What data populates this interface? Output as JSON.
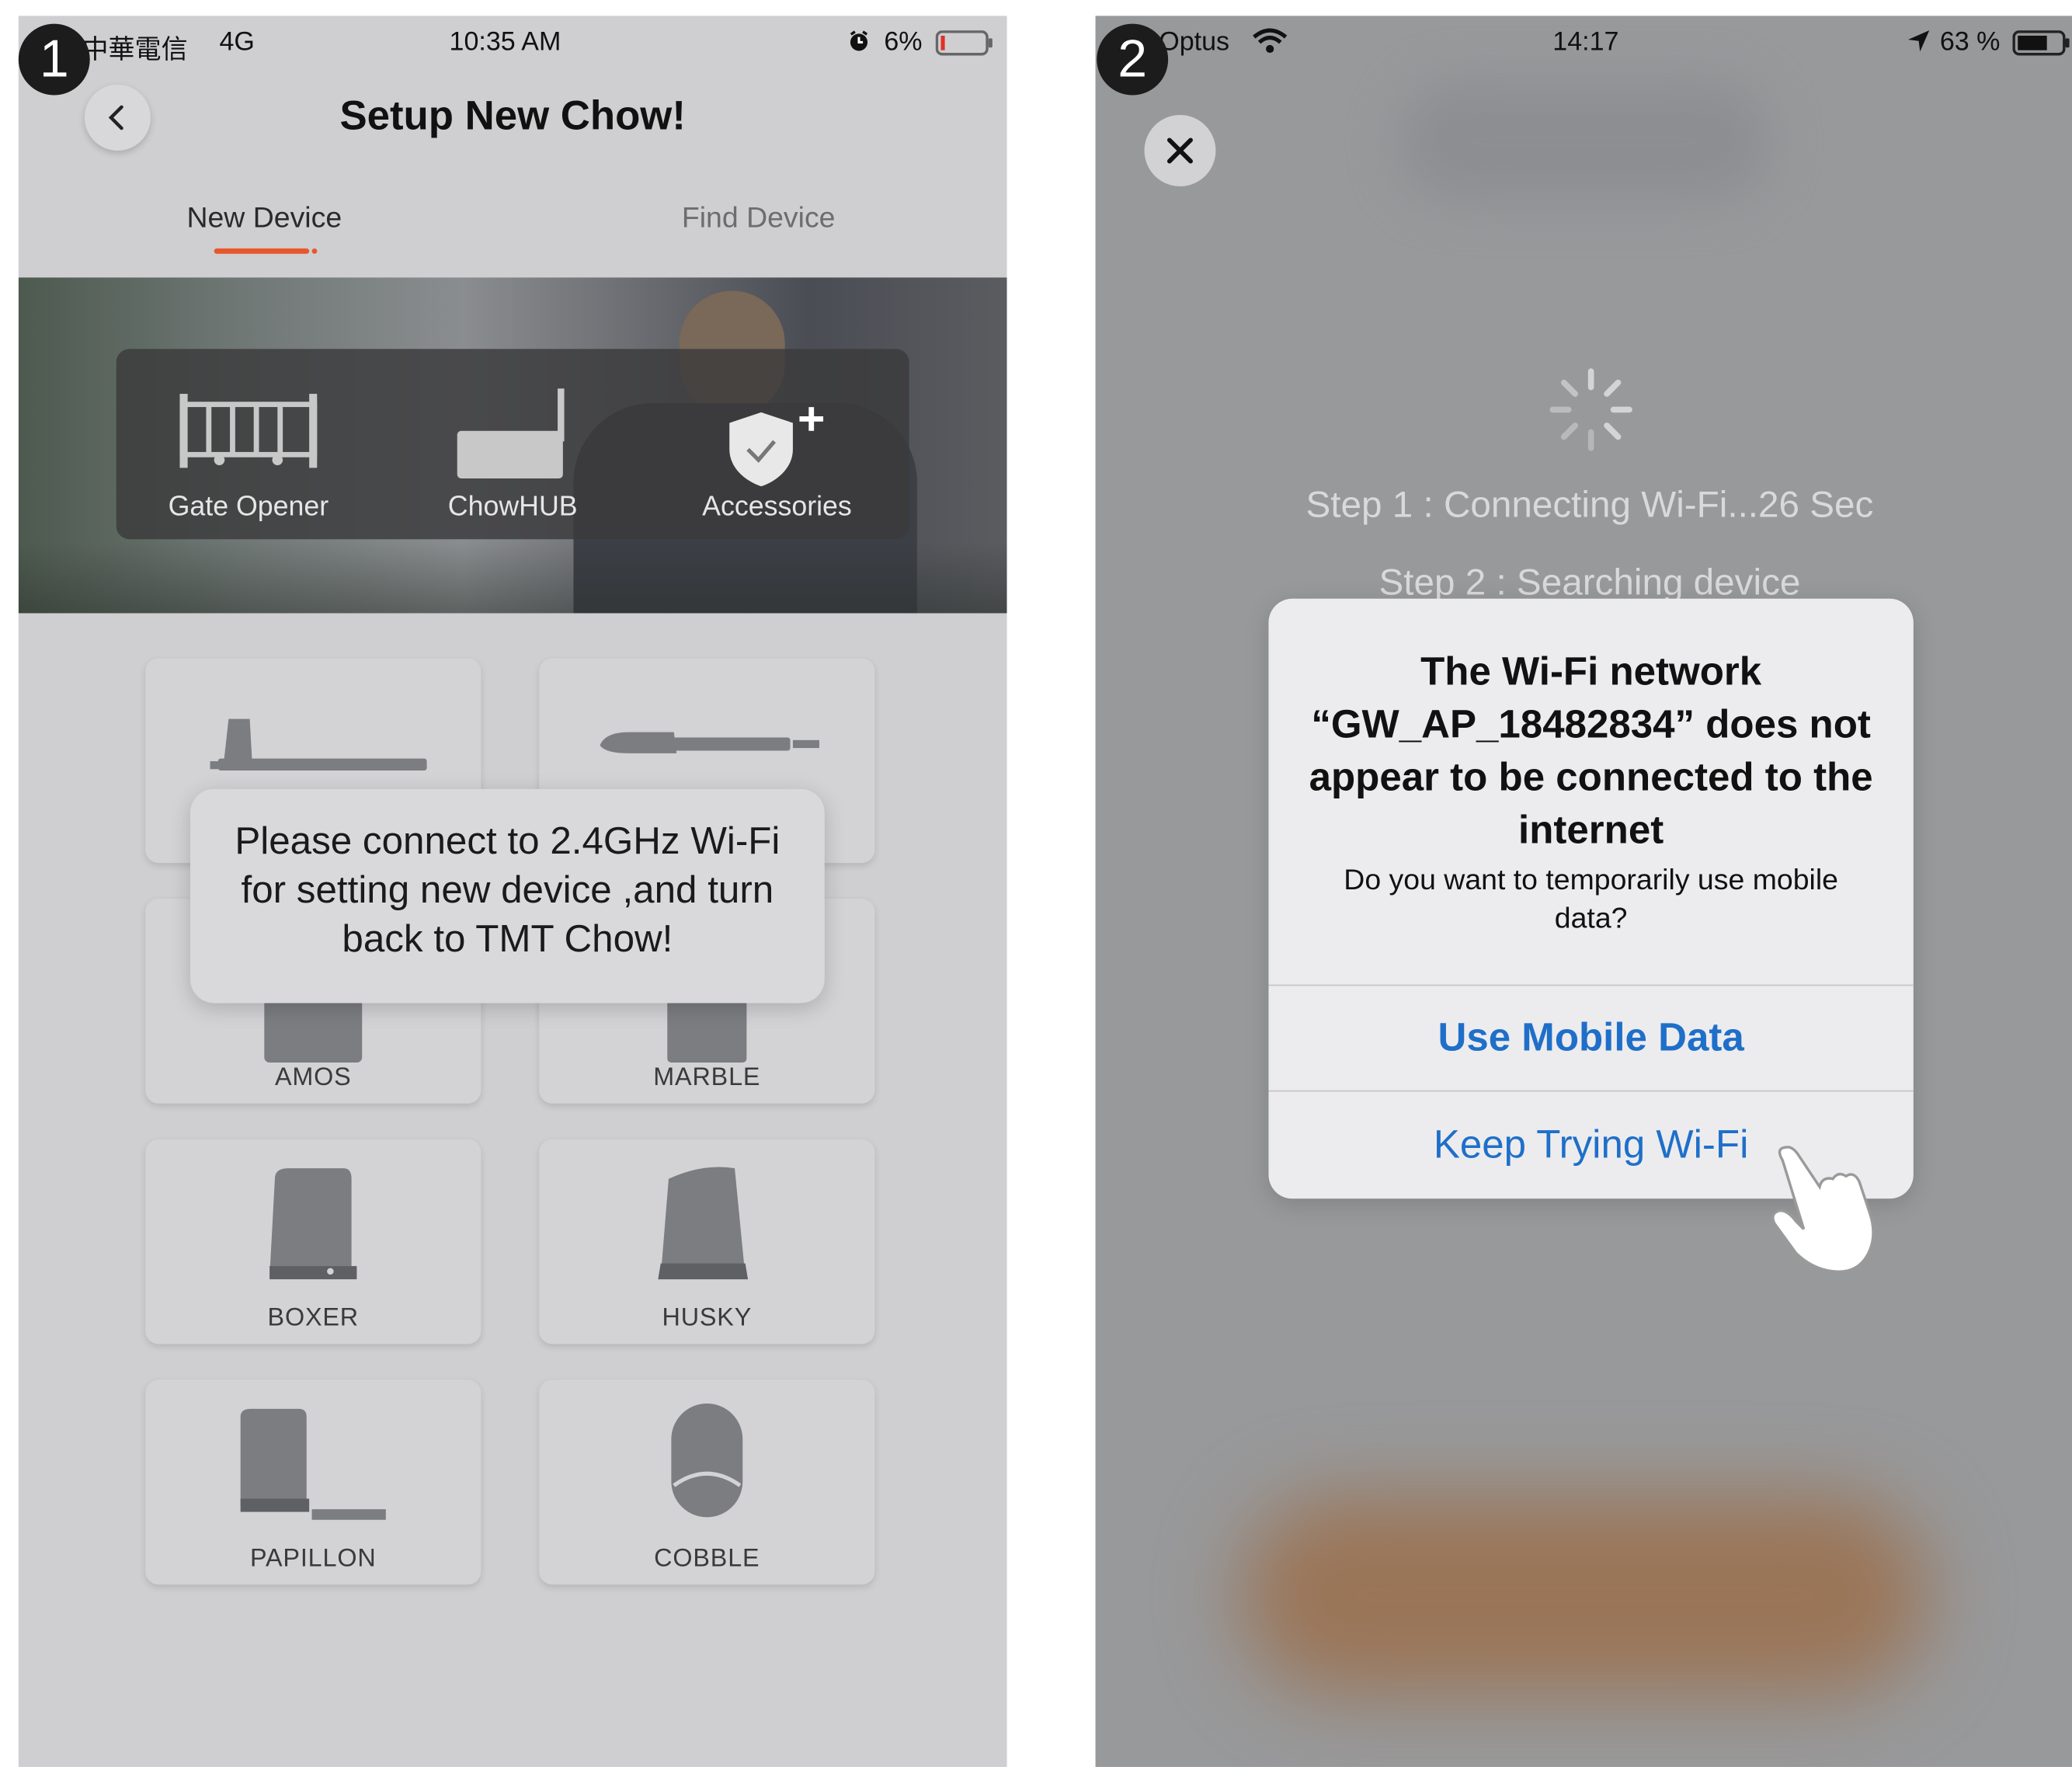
{
  "panel1": {
    "step_number": "1",
    "status_bar": {
      "carrier": "中華電信",
      "network": "4G",
      "time": "10:35 AM",
      "battery": "6%"
    },
    "back_icon": "chevron-left-icon",
    "title": "Setup New Chow!",
    "tabs": [
      "New Device",
      "Find Device"
    ],
    "categories": [
      "Gate Opener",
      "ChowHUB",
      "Accessories"
    ],
    "devices": [
      "AMOS",
      "MARBLE",
      "BOXER",
      "HUSKY",
      "PAPILLON",
      "COBBLE"
    ],
    "toast": "Please connect to 2.4GHz Wi-Fi for setting new device ,and turn back to TMT Chow!"
  },
  "panel2": {
    "step_number": "2",
    "status_bar": {
      "carrier": "Optus",
      "time": "14:17",
      "battery": "63 %"
    },
    "close_icon": "close-icon",
    "step1": "Step 1 : Connecting Wi-Fi...26 Sec",
    "step2": "Step 2 : Searching device",
    "alert": {
      "title": "The Wi-Fi network “GW_AP_18482834” does not appear to be connected to the internet",
      "message": "Do you want to temporarily use mobile data?",
      "primary_button": "Use Mobile Data",
      "secondary_button": "Keep Trying Wi-Fi"
    },
    "pointer_icon": "hand-pointer-icon"
  },
  "colors": {
    "accent_orange": "#e8572a",
    "ios_blue": "#1f6fc9",
    "battery_low": "#e0312a"
  }
}
